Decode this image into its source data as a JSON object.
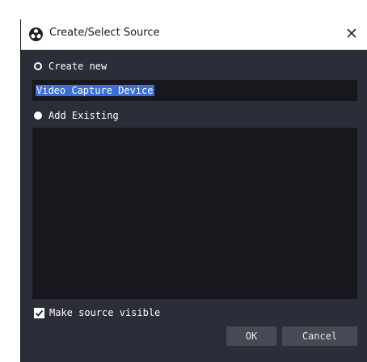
{
  "window": {
    "title": "Create/Select Source",
    "close_icon": "close-icon",
    "app_icon": "obs-logo-icon"
  },
  "create_new": {
    "label": "Create new",
    "selected": true,
    "name_value": "Video Capture Device"
  },
  "add_existing": {
    "label": "Add Existing",
    "selected": false,
    "items": []
  },
  "make_visible": {
    "label": "Make source visible",
    "checked": true
  },
  "buttons": {
    "ok_label": "OK",
    "cancel_label": "Cancel"
  },
  "colors": {
    "dialog_bg": "#2b2e38",
    "field_bg": "#16181d",
    "selection": "#3b6fd4",
    "button_bg": "#464a55"
  }
}
